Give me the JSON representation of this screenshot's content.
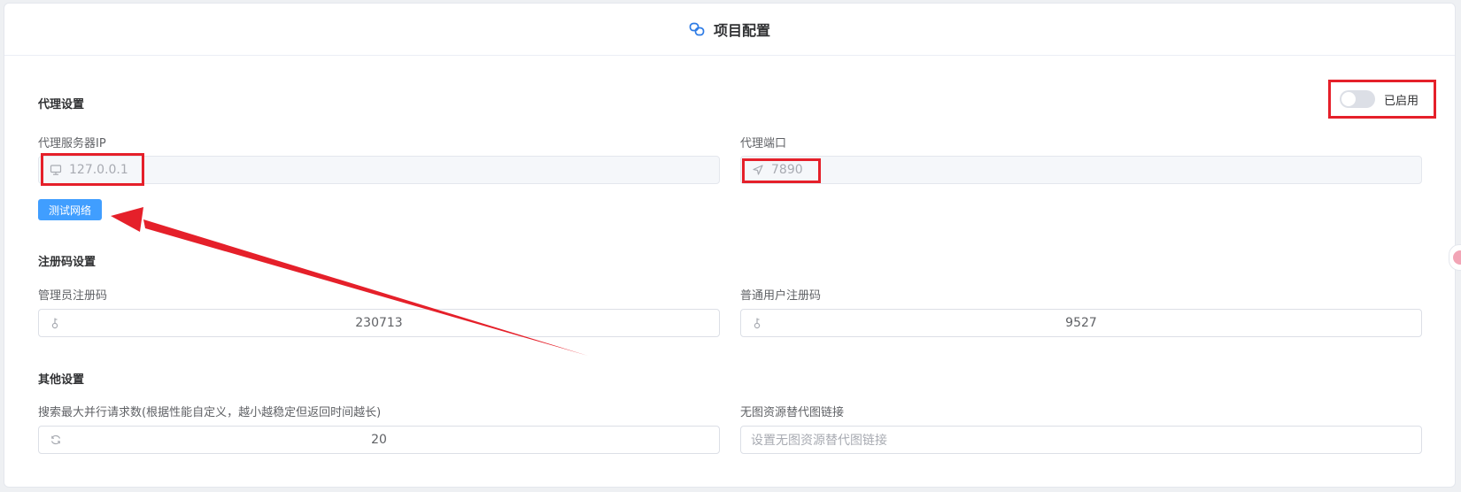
{
  "header": {
    "title": "项目配置",
    "icon": "link-icon"
  },
  "proxy": {
    "section_title": "代理设置",
    "enable_label": "已启用",
    "enabled": false,
    "ip_label": "代理服务器IP",
    "ip_value": "127.0.0.1",
    "port_label": "代理端口",
    "port_value": "7890",
    "test_button": "测试网络"
  },
  "register": {
    "section_title": "注册码设置",
    "admin_label": "管理员注册码",
    "admin_value": "230713",
    "user_label": "普通用户注册码",
    "user_value": "9527"
  },
  "other": {
    "section_title": "其他设置",
    "concurrency_label": "搜索最大并行请求数(根据性能自定义，越小越稳定但返回时间越长)",
    "concurrency_value": "20",
    "fallback_label": "无图资源替代图链接",
    "fallback_placeholder": "设置无图资源替代图链接"
  },
  "colors": {
    "primary": "#409eff",
    "annotation": "#e5202a"
  }
}
